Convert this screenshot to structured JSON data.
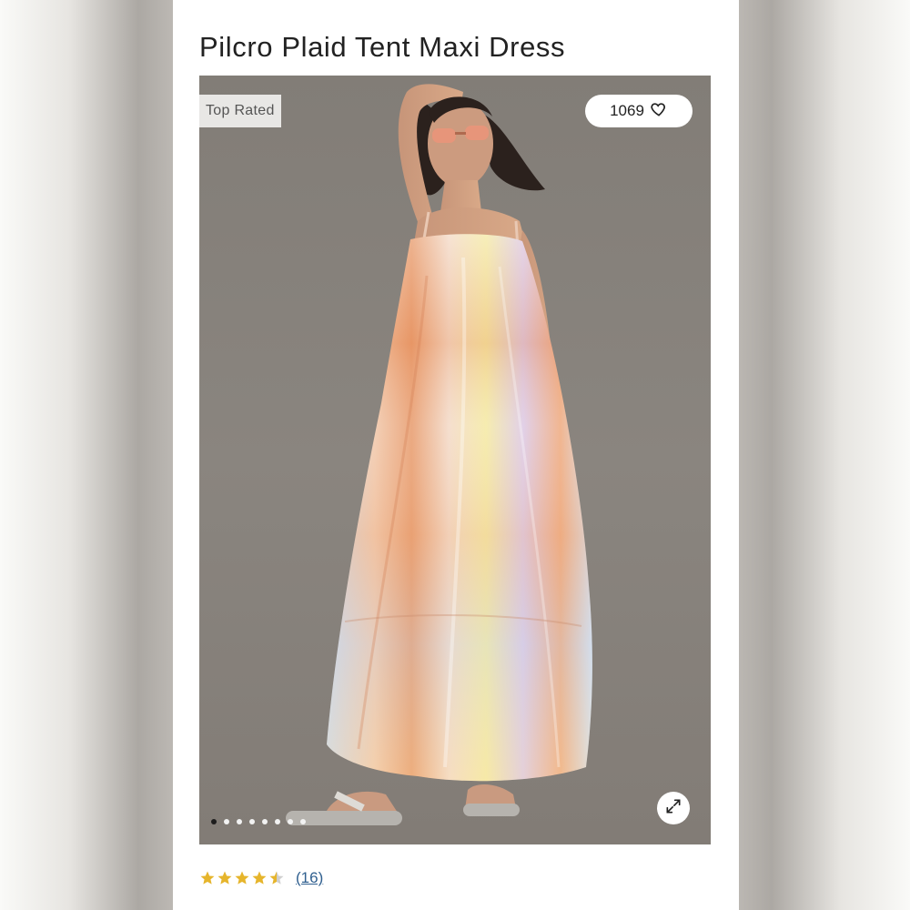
{
  "product": {
    "title": "Pilcro Plaid Tent Maxi Dress",
    "badge": "Top Rated",
    "likes": "1069",
    "rating_value": 4.5,
    "review_count_label": "(16)"
  },
  "gallery": {
    "total_images": 8,
    "active_index": 0
  },
  "colors": {
    "star": "#e6b52c",
    "link": "#2f5f8f",
    "photo_background": "#857f79"
  },
  "icons": {
    "like": "heart-icon",
    "expand": "expand-arrows-icon",
    "rating": "star-icon"
  }
}
